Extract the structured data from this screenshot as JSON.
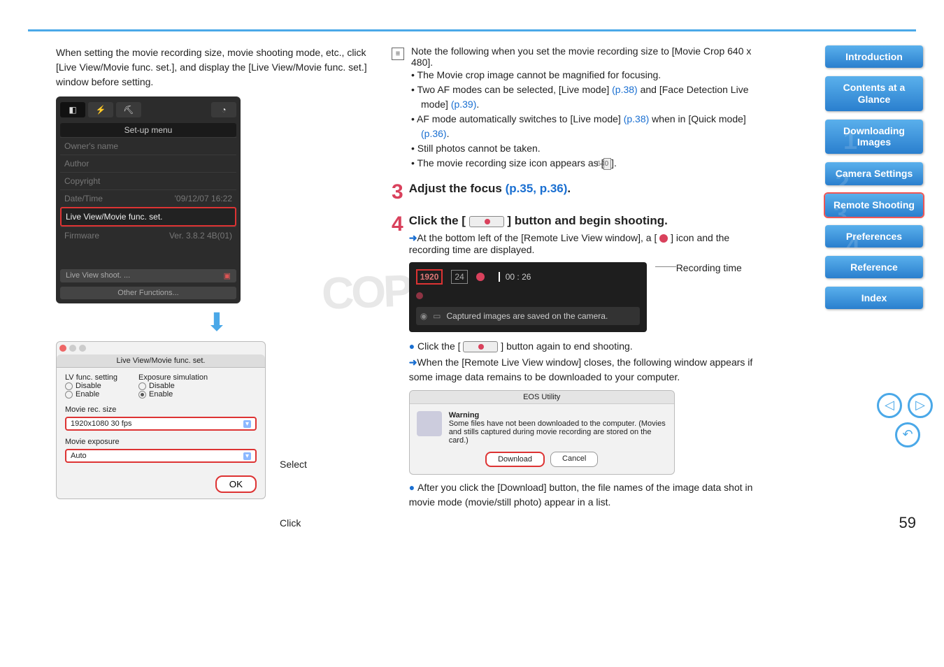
{
  "page_number": "59",
  "watermark": "COPY",
  "left": {
    "intro": "When setting the movie recording size, movie shooting mode, etc., click [Live View/Movie func. set.], and display the [Live View/Movie func. set.] window before setting.",
    "select_label": "Select",
    "click_label": "Click",
    "setup": {
      "title": "Set-up menu",
      "rows": {
        "owner": "Owner's name",
        "author": "Author",
        "copyright": "Copyright",
        "date_label": "Date/Time",
        "date_val": "'09/12/07 16:22",
        "lv": "Live View/Movie func. set.",
        "fw_label": "Firmware",
        "fw_val": "Ver. 3.8.2 4B(01)"
      },
      "btn1": "Live View shoot. ...",
      "btn2": "Other Functions..."
    },
    "dialog": {
      "title": "Live View/Movie func. set.",
      "lv_label": "LV func. setting",
      "exp_label": "Exposure simulation",
      "disable": "Disable",
      "enable": "Enable",
      "rec_label": "Movie rec. size",
      "rec_val": "1920x1080 30 fps",
      "exp_mode_label": "Movie exposure",
      "exp_mode_val": "Auto",
      "ok": "OK"
    }
  },
  "right": {
    "note_intro": "Note the following when you set the movie recording size to [Movie Crop 640 x 480].",
    "notes": {
      "n1": "The Movie crop image cannot be magnified for focusing.",
      "n2a": "Two AF modes can be selected, [Live mode] ",
      "n2b": " and [Face Detection Live mode] ",
      "n3a": "AF mode automatically switches to [Live mode] ",
      "n3b": " when in [Quick mode] ",
      "n4": "Still photos cannot be taken.",
      "n5a": "The movie recording size icon appears as [",
      "n5b": "]."
    },
    "links": {
      "p38": "(p.38)",
      "p39": "(p.39)",
      "p36": "(p.36)",
      "p3536": "(p.35, p.36)"
    },
    "icon640": "640",
    "step3_title_a": "Adjust the focus ",
    "step3_title_b": ".",
    "step4_title_a": "Click the [",
    "step4_title_b": "] button and begin shooting.",
    "step4_line_a": "At the bottom left of the [Remote Live View window], a [",
    "step4_line_b": "] icon and the recording time are displayed.",
    "lv": {
      "res": "1920",
      "fps": "24",
      "time": "00 : 26",
      "saved": "Captured images are saved on the camera."
    },
    "rec_time_label": "Recording time",
    "end_a": "Click the [",
    "end_b": "] button again to end shooting.",
    "close_text": "When the [Remote Live View window] closes, the following window appears if some image data remains to be downloaded to your computer.",
    "warn": {
      "title": "EOS Utility",
      "heading": "Warning",
      "body": "Some files have not been downloaded to the computer. (Movies and stills captured during movie recording are stored on the card.)",
      "download": "Download",
      "cancel": "Cancel"
    },
    "after": "After you click the [Download] button, the file names of the image data shot in movie mode (movie/still photo) appear in a list."
  },
  "sidebar": {
    "intro": "Introduction",
    "contents": "Contents at a Glance",
    "downloading": "Downloading Images",
    "camera": "Camera Settings",
    "remote": "Remote Shooting",
    "prefs": "Preferences",
    "reference": "Reference",
    "index": "Index",
    "nums": {
      "n1": "1",
      "n2": "2",
      "n3": "3",
      "n4": "4"
    }
  }
}
